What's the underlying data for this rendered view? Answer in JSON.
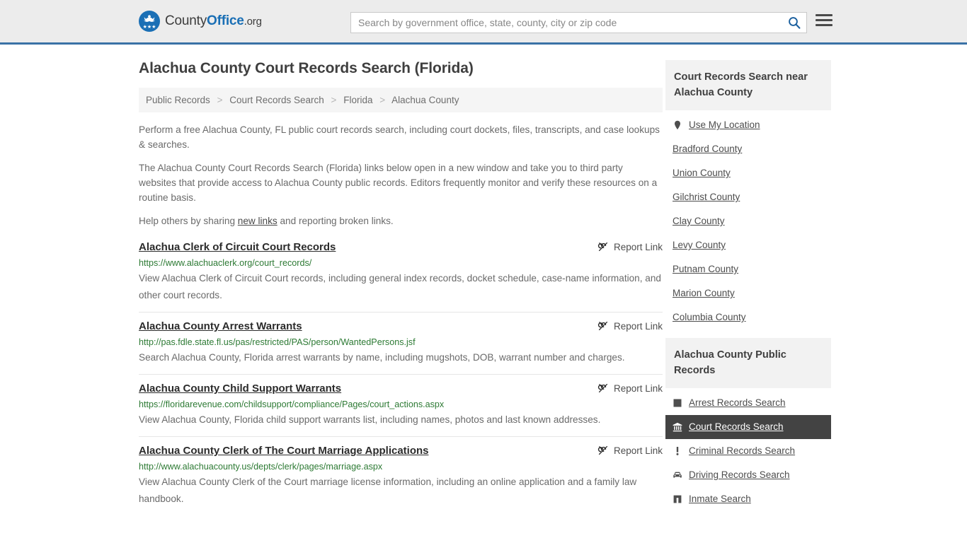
{
  "header": {
    "brand": {
      "part1": "County",
      "part2": "Office",
      "part3": ".org"
    },
    "search": {
      "placeholder": "Search by government office, state, county, city or zip code",
      "value": ""
    },
    "search_icon": "search-icon",
    "menu_icon": "hamburger-menu-icon"
  },
  "main": {
    "title": "Alachua County Court Records Search (Florida)",
    "breadcrumb": [
      "Public Records",
      "Court Records Search",
      "Florida",
      "Alachua County"
    ],
    "breadcrumb_separator": ">",
    "intro": {
      "p1": "Perform a free Alachua County, FL public court records search, including court dockets, files, transcripts, and case lookups & searches.",
      "p2": "The Alachua County Court Records Search (Florida) links below open in a new window and take you to third party websites that provide access to Alachua County public records. Editors frequently monitor and verify these resources on a routine basis.",
      "p3_before": "Help others by sharing ",
      "p3_link": "new links",
      "p3_after": " and reporting broken links."
    },
    "report_link_label": "Report Link",
    "report_link_icon": "broken-link-icon",
    "results": [
      {
        "title": "Alachua Clerk of Circuit Court Records",
        "url": "https://www.alachuaclerk.org/court_records/",
        "description": "View Alachua Clerk of Circuit Court records, including general index records, docket schedule, case-name information, and other court records."
      },
      {
        "title": "Alachua County Arrest Warrants",
        "url": "http://pas.fdle.state.fl.us/pas/restricted/PAS/person/WantedPersons.jsf",
        "description": "Search Alachua County, Florida arrest warrants by name, including mugshots, DOB, warrant number and charges."
      },
      {
        "title": "Alachua County Child Support Warrants",
        "url": "https://floridarevenue.com/childsupport/compliance/Pages/court_actions.aspx",
        "description": "View Alachua County, Florida child support warrants list, including names, photos and last known addresses."
      },
      {
        "title": "Alachua County Clerk of The Court Marriage Applications",
        "url": "http://www.alachuacounty.us/depts/clerk/pages/marriage.aspx",
        "description": "View Alachua County Clerk of the Court marriage license information, including an online application and a family law handbook."
      }
    ]
  },
  "sidebar": {
    "nearby": {
      "heading": "Court Records Search near Alachua County",
      "items": [
        {
          "label": "Use My Location",
          "icon": "map-pin-icon"
        },
        {
          "label": "Bradford County",
          "icon": ""
        },
        {
          "label": "Union County",
          "icon": ""
        },
        {
          "label": "Gilchrist County",
          "icon": ""
        },
        {
          "label": "Clay County",
          "icon": ""
        },
        {
          "label": "Levy County",
          "icon": ""
        },
        {
          "label": "Putnam County",
          "icon": ""
        },
        {
          "label": "Marion County",
          "icon": ""
        },
        {
          "label": "Columbia County",
          "icon": ""
        }
      ]
    },
    "public_records": {
      "heading": "Alachua County Public Records",
      "items": [
        {
          "label": "Arrest Records Search",
          "icon": "square-icon",
          "active": false
        },
        {
          "label": "Court Records Search",
          "icon": "courthouse-icon",
          "active": true
        },
        {
          "label": "Criminal Records Search",
          "icon": "exclamation-icon",
          "active": false
        },
        {
          "label": "Driving Records Search",
          "icon": "car-icon",
          "active": false
        },
        {
          "label": "Inmate Search",
          "icon": "jail-icon",
          "active": false
        }
      ]
    }
  },
  "colors": {
    "brand_blue": "#1a6fb5",
    "header_bg": "#ececec",
    "header_border": "#3b72a6",
    "url_green": "#2d7a34",
    "active_bg": "#434343",
    "panel_bg": "#f2f2f2"
  }
}
